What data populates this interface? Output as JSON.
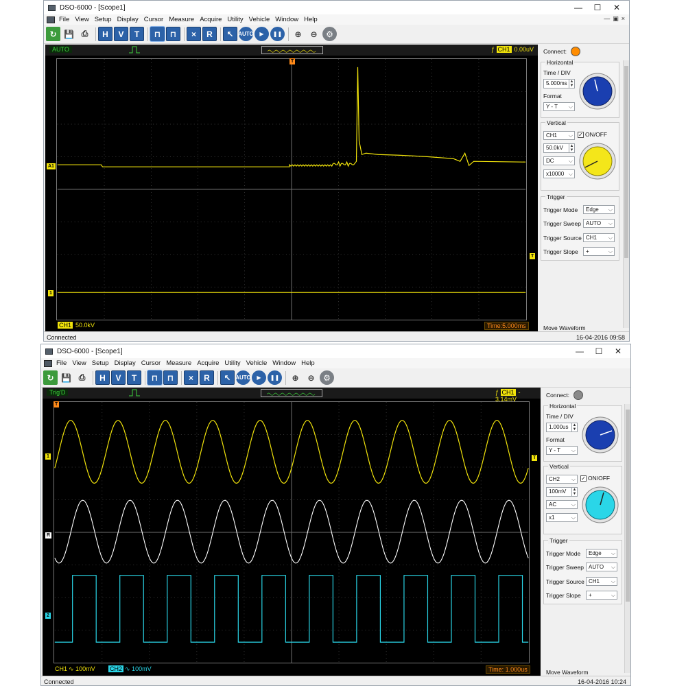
{
  "windows": [
    {
      "title": "DSO-6000 - [Scope1]",
      "menu": [
        "File",
        "View",
        "Setup",
        "Display",
        "Cursor",
        "Measure",
        "Acquire",
        "Utility",
        "Vehicle",
        "Window",
        "Help"
      ],
      "trigger_status": "AUTO",
      "trigger_channel": "CH1",
      "trigger_level": "0.00uV",
      "channel_readout": {
        "tag": "CH1",
        "text": "50.0kV"
      },
      "time_readout": "Time:5.000ms",
      "markers": {
        "trigger_top": "T",
        "ch_level": "A1",
        "ch_ground": "1",
        "trigger_right": "T"
      },
      "panel": {
        "connect_label": "Connect:",
        "connect_color": "#ff8c00",
        "horizontal_label": "Horizontal",
        "time_div_label": "Time / DIV",
        "time_div_value": "5.000ms",
        "format_label": "Format",
        "format_value": "Y - T",
        "vertical_label": "Vertical",
        "channel_value": "CH1",
        "onoff_label": "ON/OFF",
        "volts_value": "50.0kV",
        "coupling_value": "DC",
        "probe_value": "x10000",
        "knob_color": "#f4e61a",
        "time_knob_color": "#1a3fb0",
        "trigger_label": "Trigger",
        "trigger_mode_label": "Trigger Mode",
        "trigger_mode_value": "Edge",
        "trigger_sweep_label": "Trigger Sweep",
        "trigger_sweep_value": "AUTO",
        "trigger_source_label": "Trigger Source",
        "trigger_source_value": "CH1",
        "trigger_slope_label": "Trigger Slope",
        "trigger_slope_value": "+",
        "move_waveform_label": "Move Waveform"
      },
      "status_text": "Connected",
      "status_time": "16-04-2016  09:58"
    },
    {
      "title": "DSO-6000 - [Scope1]",
      "menu": [
        "File",
        "View",
        "Setup",
        "Display",
        "Cursor",
        "Measure",
        "Acquire",
        "Utility",
        "Vehicle",
        "Window",
        "Help"
      ],
      "trigger_status": "Trig'D",
      "trigger_channel": "CH1",
      "trigger_level": "-3.14mV",
      "channel_readout": [
        {
          "tag": "CH1",
          "text": "∿ 100mV"
        },
        {
          "tag": "CH2",
          "text": "∿ 100mV"
        }
      ],
      "time_readout": "Time: 1.000us",
      "markers": {
        "trigger_top": "T",
        "ch1": "1",
        "ref": "R",
        "ch2": "2",
        "trigger_right": "T"
      },
      "panel": {
        "connect_label": "Connect:",
        "connect_color": "#8a8a8a",
        "horizontal_label": "Horizontal",
        "time_div_label": "Time / DIV",
        "time_div_value": "1.000us",
        "format_label": "Format",
        "format_value": "Y - T",
        "vertical_label": "Vertical",
        "channel_value": "CH2",
        "onoff_label": "ON/OFF",
        "volts_value": "100mV",
        "coupling_value": "AC",
        "probe_value": "x1",
        "knob_color": "#2ad6e8",
        "time_knob_color": "#1a3fb0",
        "trigger_label": "Trigger",
        "trigger_mode_label": "Trigger Mode",
        "trigger_mode_value": "Edge",
        "trigger_sweep_label": "Trigger Sweep",
        "trigger_sweep_value": "AUTO",
        "trigger_source_label": "Trigger Source",
        "trigger_source_value": "CH1",
        "trigger_slope_label": "Trigger Slope",
        "trigger_slope_value": "+",
        "move_waveform_label": "Move Waveform"
      },
      "status_text": "Connected",
      "status_time": "16-04-2016  10:24"
    }
  ],
  "colors": {
    "ch1": "#f2e40b",
    "ch2": "#2ad6e8",
    "ref": "#ffffff",
    "grid": "#6f6f6f"
  }
}
